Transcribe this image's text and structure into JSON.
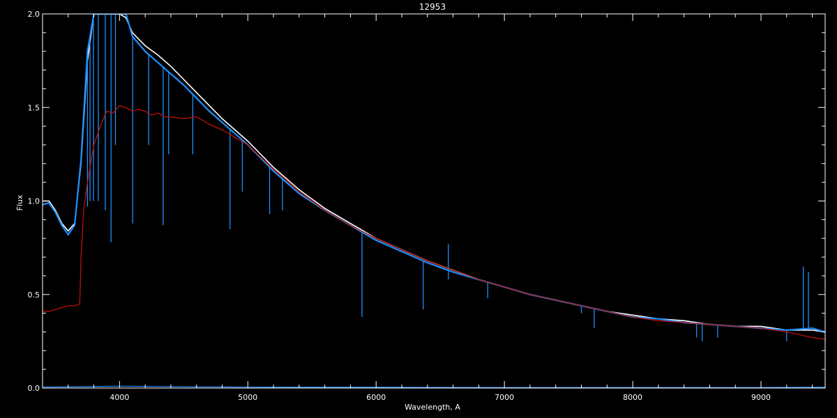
{
  "chart_data": {
    "type": "line",
    "title": "12953",
    "xlabel": "Wavelength, A",
    "ylabel": "Flux",
    "xlim": [
      3400,
      9500
    ],
    "ylim": [
      0.0,
      2.0
    ],
    "x_ticks": [
      4000,
      5000,
      6000,
      7000,
      8000,
      9000
    ],
    "y_ticks": [
      0.0,
      0.5,
      1.0,
      1.5,
      2.0
    ],
    "y_tick_labels": [
      "0.0",
      "0.5",
      "1.0",
      "1.5",
      "2.0"
    ],
    "grid": false,
    "colors": {
      "background": "#000000",
      "axes": "#ffffff",
      "observed": "#ffffff",
      "model": "#1e90ff",
      "fit": "#c0100a",
      "error": "#1e90ff"
    },
    "series": [
      {
        "key": "observed",
        "x": [
          3400,
          3450,
          3500,
          3550,
          3600,
          3650,
          3700,
          3750,
          3800,
          3900,
          4000,
          4050,
          4100,
          4200,
          4300,
          4400,
          4500,
          4600,
          4700,
          4800,
          4900,
          5000,
          5200,
          5400,
          5600,
          5800,
          6000,
          6200,
          6400,
          6600,
          6800,
          7000,
          7200,
          7400,
          7600,
          7800,
          8000,
          8200,
          8400,
          8600,
          8800,
          9000,
          9200,
          9400,
          9500
        ],
        "y": [
          1.0,
          1.0,
          0.95,
          0.88,
          0.84,
          0.88,
          1.2,
          1.75,
          2.0,
          2.0,
          2.0,
          1.98,
          1.9,
          1.83,
          1.78,
          1.72,
          1.65,
          1.58,
          1.51,
          1.44,
          1.38,
          1.32,
          1.18,
          1.06,
          0.96,
          0.88,
          0.8,
          0.74,
          0.68,
          0.63,
          0.58,
          0.54,
          0.5,
          0.47,
          0.44,
          0.41,
          0.39,
          0.37,
          0.36,
          0.34,
          0.33,
          0.33,
          0.31,
          0.31,
          0.3
        ]
      },
      {
        "key": "model",
        "x": [
          3400,
          3450,
          3500,
          3550,
          3600,
          3650,
          3700,
          3750,
          3800,
          3900,
          4000,
          4050,
          4100,
          4200,
          4300,
          4400,
          4500,
          4600,
          4700,
          4800,
          4900,
          5000,
          5200,
          5400,
          5600,
          5800,
          6000,
          6200,
          6400,
          6600,
          6800,
          7000,
          7200,
          7400,
          7600,
          7800,
          8000,
          8200,
          8400,
          8600,
          8800,
          9000,
          9200,
          9400,
          9500
        ],
        "y": [
          0.98,
          0.99,
          0.94,
          0.87,
          0.82,
          0.87,
          1.22,
          1.8,
          2.0,
          2.0,
          2.0,
          2.0,
          1.88,
          1.8,
          1.74,
          1.68,
          1.62,
          1.55,
          1.48,
          1.42,
          1.36,
          1.3,
          1.16,
          1.04,
          0.95,
          0.87,
          0.79,
          0.73,
          0.67,
          0.62,
          0.58,
          0.54,
          0.5,
          0.47,
          0.44,
          0.41,
          0.38,
          0.37,
          0.35,
          0.34,
          0.33,
          0.32,
          0.31,
          0.32,
          0.3
        ]
      },
      {
        "key": "fit",
        "x": [
          3400,
          3450,
          3500,
          3550,
          3600,
          3650,
          3690,
          3700,
          3720,
          3750,
          3800,
          3850,
          3900,
          3950,
          4000,
          4050,
          4100,
          4150,
          4200,
          4250,
          4300,
          4350,
          4400,
          4500,
          4600,
          4700,
          4800,
          4900,
          5000,
          5200,
          5400,
          5600,
          5800,
          6000,
          6200,
          6400,
          6600,
          6800,
          7000,
          7200,
          7400,
          7600,
          7800,
          8000,
          8200,
          8400,
          8600,
          8800,
          9000,
          9200,
          9400,
          9500
        ],
        "y": [
          0.41,
          0.41,
          0.42,
          0.43,
          0.44,
          0.44,
          0.45,
          0.7,
          0.95,
          1.1,
          1.3,
          1.4,
          1.48,
          1.47,
          1.51,
          1.5,
          1.48,
          1.49,
          1.48,
          1.46,
          1.47,
          1.45,
          1.45,
          1.44,
          1.45,
          1.41,
          1.38,
          1.34,
          1.3,
          1.17,
          1.05,
          0.95,
          0.87,
          0.8,
          0.74,
          0.68,
          0.63,
          0.58,
          0.54,
          0.5,
          0.47,
          0.44,
          0.41,
          0.38,
          0.36,
          0.35,
          0.34,
          0.33,
          0.32,
          0.3,
          0.27,
          0.26
        ]
      },
      {
        "key": "error",
        "x": [
          3400,
          4000,
          5000,
          6000,
          7000,
          8000,
          9000,
          9500
        ],
        "y": [
          0.005,
          0.01,
          0.005,
          0.004,
          0.003,
          0.003,
          0.003,
          0.004
        ]
      }
    ],
    "absorption_lines": [
      {
        "x": 3750,
        "depth_to": 0.97
      },
      {
        "x": 3770,
        "depth_to": 1.0
      },
      {
        "x": 3797,
        "depth_to": 1.0
      },
      {
        "x": 3835,
        "depth_to": 1.0
      },
      {
        "x": 3889,
        "depth_to": 0.95
      },
      {
        "x": 3934,
        "depth_to": 0.78
      },
      {
        "x": 3968,
        "depth_to": 1.3
      },
      {
        "x": 4102,
        "depth_to": 0.88
      },
      {
        "x": 4227,
        "depth_to": 1.3
      },
      {
        "x": 4340,
        "depth_to": 0.87
      },
      {
        "x": 4383,
        "depth_to": 1.25
      },
      {
        "x": 4571,
        "depth_to": 1.25
      },
      {
        "x": 4861,
        "depth_to": 0.85
      },
      {
        "x": 4957,
        "depth_to": 1.05
      },
      {
        "x": 5170,
        "depth_to": 0.93
      },
      {
        "x": 5270,
        "depth_to": 0.95
      },
      {
        "x": 5890,
        "depth_to": 0.38
      },
      {
        "x": 6367,
        "depth_to": 0.42
      },
      {
        "x": 6563,
        "depth_to": 0.58
      },
      {
        "x": 6870,
        "depth_to": 0.48
      },
      {
        "x": 7600,
        "depth_to": 0.4
      },
      {
        "x": 7700,
        "depth_to": 0.32
      },
      {
        "x": 8498,
        "depth_to": 0.27
      },
      {
        "x": 8542,
        "depth_to": 0.25
      },
      {
        "x": 8662,
        "depth_to": 0.27
      },
      {
        "x": 9200,
        "depth_to": 0.25
      }
    ],
    "emission_spikes": [
      {
        "x": 6563,
        "peak": 0.77
      },
      {
        "x": 9330,
        "peak": 0.65
      },
      {
        "x": 9370,
        "peak": 0.62
      }
    ]
  }
}
